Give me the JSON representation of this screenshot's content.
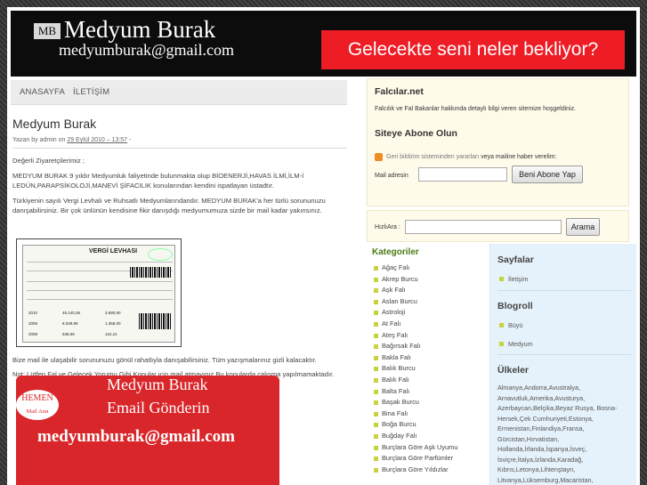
{
  "header": {
    "logo_badge": "MB",
    "site_title": "Medyum Burak",
    "site_email": "medyumburak@gmail.com",
    "banner_text": "Gelecekte seni neler bekliyor?",
    "banner_color": "#ee1c25"
  },
  "nav": {
    "items": [
      "ANASAYFA",
      "İLETİŞİM"
    ]
  },
  "post": {
    "title": "Medyum Burak",
    "meta_prefix": "Yazan by admin on ",
    "meta_date": "29 Eylül 2010 – 13:57",
    "meta_suffix": " -",
    "p1": "Değerli Ziyaretçilerimiz ;",
    "p2": "MEDYUM BURAK 9 yıldır Medyumluk faliyetinde bulunmakta olup BİOENERJİ,HAVAS İLMİ,İLM-İ LEDÜN,PARAPSİKOLOJİ,MANEVİ ŞİFACILIK konularından kendini ispatlayan üstadtır.",
    "p3": "Türkiyenin sayılı Vergi Levhalı ve Ruhsatlı Medyumlarındandır. MEDYUM BURAK'a her türlü sorununuzu danışabilirsiniz. Bir çok ünlünün kendisine fikir danışdığı medyumumuza sizde bir mail kadar yakınsınız.",
    "p4": "Bize mail ile ulaşabilir sorununuzu gönül rahatlıyla danışabilirsiniz. Tüm yazışmalarınız gizli kalacaktır.",
    "p5": "Not: Lütfen Fal ve Gelecek Yorumu Gibi Konular için mail atmayınız.Bu konularda çalışma yapılmamaktadır."
  },
  "tax_certificate": {
    "heading": "VERGİ LEVHASI",
    "rows": [
      {
        "year": "2010",
        "amount": "46.140,36",
        "tax": "3.690,90"
      },
      {
        "year": "2009",
        "amount": "6.029,99",
        "tax": "1.368,00"
      },
      {
        "year": "2008",
        "amount": "538,69",
        "tax": "124,21"
      }
    ]
  },
  "promo": {
    "badge_top": "HEMEN",
    "badge_bottom": "Mail Atın",
    "line1": "Medyum Burak",
    "line2": "Email Gönderin",
    "email": "medyumburak@gmail.com",
    "color": "#d9262a"
  },
  "sidebar": {
    "falcilar_title": "Falcılar.net",
    "falcilar_text": "Falcılık ve Fal Bakanlar hakkında detaylı bilgi veren sitemize hoşgeldiniz.",
    "subscribe_title": "Siteye Abone Olun",
    "subscribe_text_a": "Geri bildirim sisteminden yararları ",
    "subscribe_text_b": "veya mailine haber verelim:",
    "mail_label": "Mail adresin",
    "subscribe_button": "Beni Abone Yap",
    "search_label": "HızlıAra :",
    "search_button": "Arama",
    "accent_color": "#fffbea"
  },
  "categories": {
    "title": "Kategoriler",
    "items": [
      "Ağaç Falı",
      "Akrep Burcu",
      "Aşk Falı",
      "Aslan Burcu",
      "Astroloji",
      "At Falı",
      "Ateş Falı",
      "Bağırsak Falı",
      "Bakla Falı",
      "Balık Burcu",
      "Balık Falı",
      "Balta Falı",
      "Başak Burcu",
      "Bina Falı",
      "Boğa Burcu",
      "Buğday Falı",
      "Burçlara Göre Aşk Uyumu",
      "Burçlara Göre Parfümler",
      "Burçlara Göre Yıldızlar"
    ]
  },
  "pages": {
    "title": "Sayfalar",
    "items": [
      "İletişim"
    ]
  },
  "blogroll": {
    "title": "Blogroll",
    "items": [
      "Büyü",
      "Medyum"
    ]
  },
  "countries": {
    "title": "Ülkeler",
    "text": "Almanya,Andorra,Avustralya, Arnavutluk,Amerika,Avusturya, Azerbaycan,Belçika,Beyaz Rusya, Bosna-Hersek,Çek Cumhuriyeti,Estonya, Ermenistan,Finlandiya,Fransa, Gürcistan,Hırvatistan, Hollanda,İrlanda,İspanya,İsveç, İsviçre,İtalya,İzlanda,Karadağ, Kıbrıs,Letonya,Lihtenştayn, Litvanya,Lüksemburg,Macaristan,"
  }
}
